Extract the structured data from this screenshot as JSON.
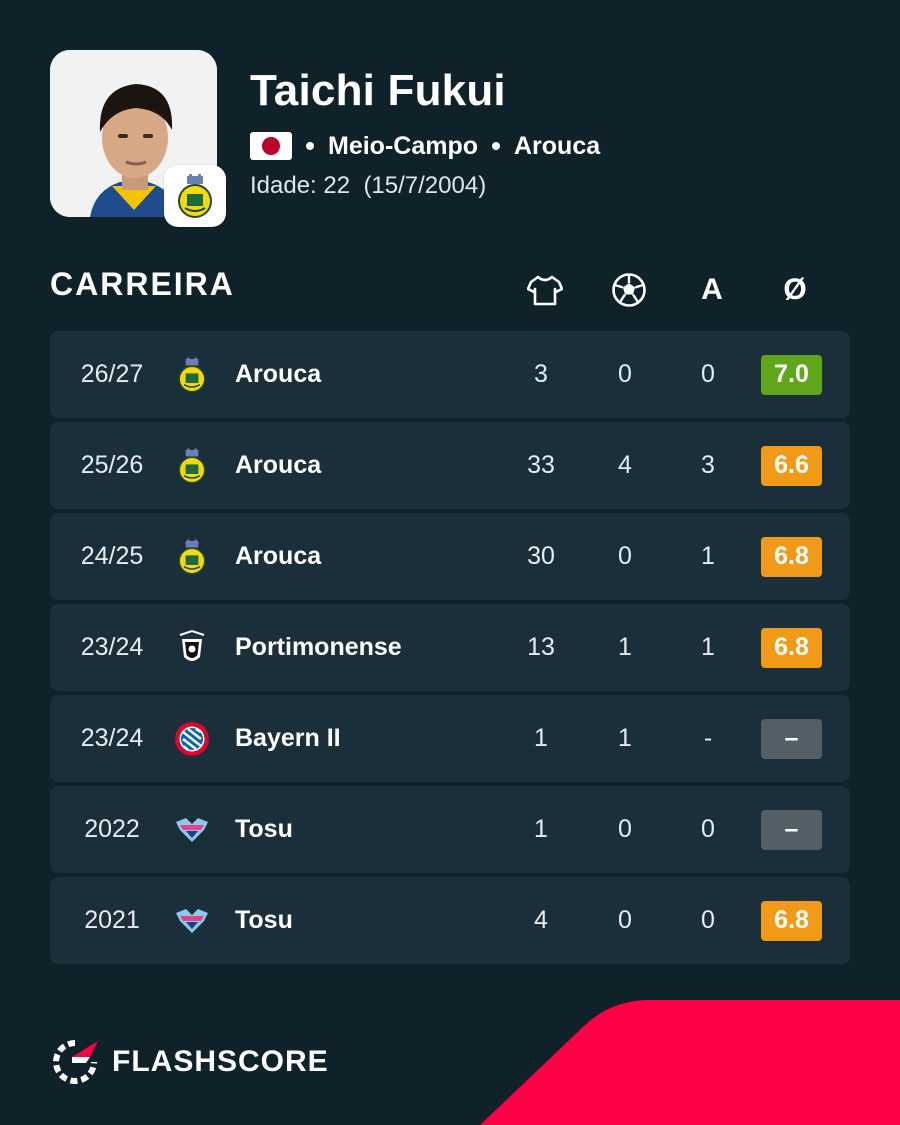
{
  "player": {
    "name": "Taichi Fukui",
    "flag": "japan-flag",
    "position": "Meio-Campo",
    "club": "Arouca",
    "age_label": "Idade: 22",
    "birth_date": "(15/7/2004)"
  },
  "career": {
    "title": "CARREIRA",
    "column_icons": [
      "shirt-icon",
      "ball-icon"
    ],
    "assists_header": "A",
    "rating_header": "Ø",
    "rows": [
      {
        "season": "26/27",
        "crest": "arouca-crest",
        "team": "Arouca",
        "apps": "3",
        "goals": "0",
        "assists": "0",
        "rating": "7.0",
        "rating_color": "#5fa61a"
      },
      {
        "season": "25/26",
        "crest": "arouca-crest",
        "team": "Arouca",
        "apps": "33",
        "goals": "4",
        "assists": "3",
        "rating": "6.6",
        "rating_color": "#f09a17"
      },
      {
        "season": "24/25",
        "crest": "arouca-crest",
        "team": "Arouca",
        "apps": "30",
        "goals": "0",
        "assists": "1",
        "rating": "6.8",
        "rating_color": "#f09a17"
      },
      {
        "season": "23/24",
        "crest": "portimonense-crest",
        "team": "Portimonense",
        "apps": "13",
        "goals": "1",
        "assists": "1",
        "rating": "6.8",
        "rating_color": "#f09a17"
      },
      {
        "season": "23/24",
        "crest": "bayern-crest",
        "team": "Bayern II",
        "apps": "1",
        "goals": "1",
        "assists": "-",
        "rating": "–",
        "rating_color": "#525f66"
      },
      {
        "season": "2022",
        "crest": "tosu-crest",
        "team": "Tosu",
        "apps": "1",
        "goals": "0",
        "assists": "0",
        "rating": "–",
        "rating_color": "#525f66"
      },
      {
        "season": "2021",
        "crest": "tosu-crest",
        "team": "Tosu",
        "apps": "4",
        "goals": "0",
        "assists": "0",
        "rating": "6.8",
        "rating_color": "#f09a17"
      }
    ]
  },
  "brand": {
    "name": "FLASHSCORE",
    "accent": "#ff0046",
    "background": "#0f2129",
    "row_background": "#1a2f39"
  }
}
